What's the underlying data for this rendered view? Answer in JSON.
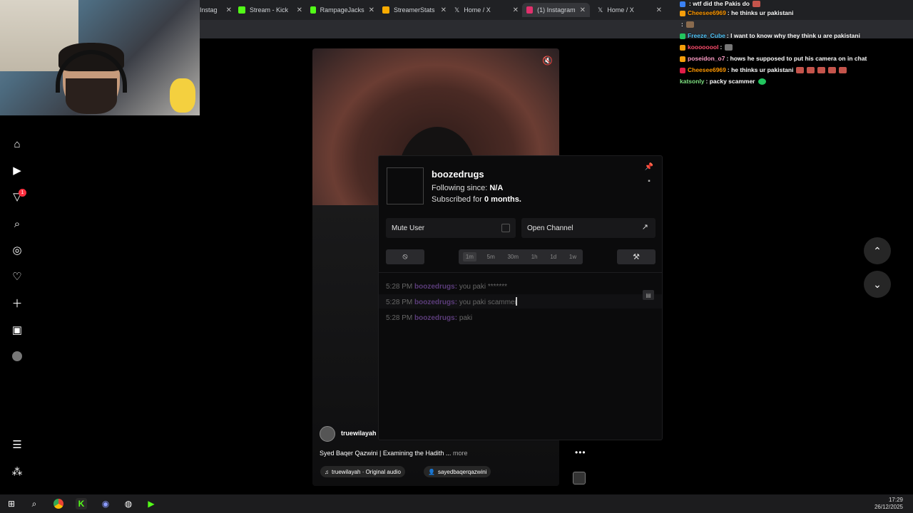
{
  "browser": {
    "tabs": [
      {
        "label": "Instag",
        "favicon_color": "#e1306c"
      },
      {
        "label": "Stream - Kick",
        "favicon_color": "#53fc18"
      },
      {
        "label": "RampageJacks",
        "favicon_color": "#53fc18"
      },
      {
        "label": "StreamerStats",
        "favicon_color": "#f9ab00"
      },
      {
        "label": "Home / X",
        "favicon_color": "#ffffff"
      },
      {
        "label": "(1) Instagram",
        "favicon_color": "#e1306c"
      },
      {
        "label": "Home / X",
        "favicon_color": "#ffffff"
      }
    ]
  },
  "sidebar": {
    "notification_count": "1"
  },
  "reel": {
    "author": "truewilayah",
    "caption": "Syed Baqer Qazwini | Examining the Hadith ...",
    "more_label": "more",
    "audio_chip": "truewilayah · Original audio",
    "tag_chip": "sayedbaqerqazwini"
  },
  "popup": {
    "username": "boozedrugs",
    "following_label": "Following since: ",
    "following_value": "N/A",
    "subscribed_prefix": "Subscribed for ",
    "subscribed_value": "0 months.",
    "mute_label": "Mute User",
    "open_channel_label": "Open Channel",
    "timeouts": [
      "1m",
      "5m",
      "30m",
      "1h",
      "1d",
      "1w"
    ],
    "messages": [
      {
        "time": "5:28 PM",
        "user": "boozedrugs:",
        "text": "you paki *******"
      },
      {
        "time": "5:28 PM",
        "user": "boozedrugs:",
        "text": "you paki scammer"
      },
      {
        "time": "5:28 PM",
        "user": "boozedrugs:",
        "text": "paki"
      }
    ]
  },
  "chat_overlay": [
    {
      "user": "Freeze_Cube",
      "text": ": I want to know why they think u are pakistani",
      "color": "#4fc3f7"
    },
    {
      "user": "koooooool",
      "text": ":",
      "color": "#ff4d6d"
    },
    {
      "user": "poseidon_o7",
      "text": ": hows he supposed to put his camera on in chat",
      "color": "#ff9ec7"
    },
    {
      "user": "Cheesee6969",
      "text": ": he thinks ur pakistani",
      "color": "#ff9800"
    },
    {
      "user": "katsonly",
      "text": ": packy scammer",
      "color": "#7ee081"
    }
  ],
  "chat_overlay_top": [
    {
      "user": "",
      "text": ": wtf did the Pakis do",
      "color": "#ff4d6d"
    },
    {
      "user": "Cheesee6969",
      "text": ": he thinks ur pakistani",
      "color": "#ff9800"
    },
    {
      "user": "",
      "text": ":",
      "color": "#ff4d6d"
    }
  ],
  "taskbar": {
    "time": "17:29",
    "date": "26/12/2025"
  }
}
